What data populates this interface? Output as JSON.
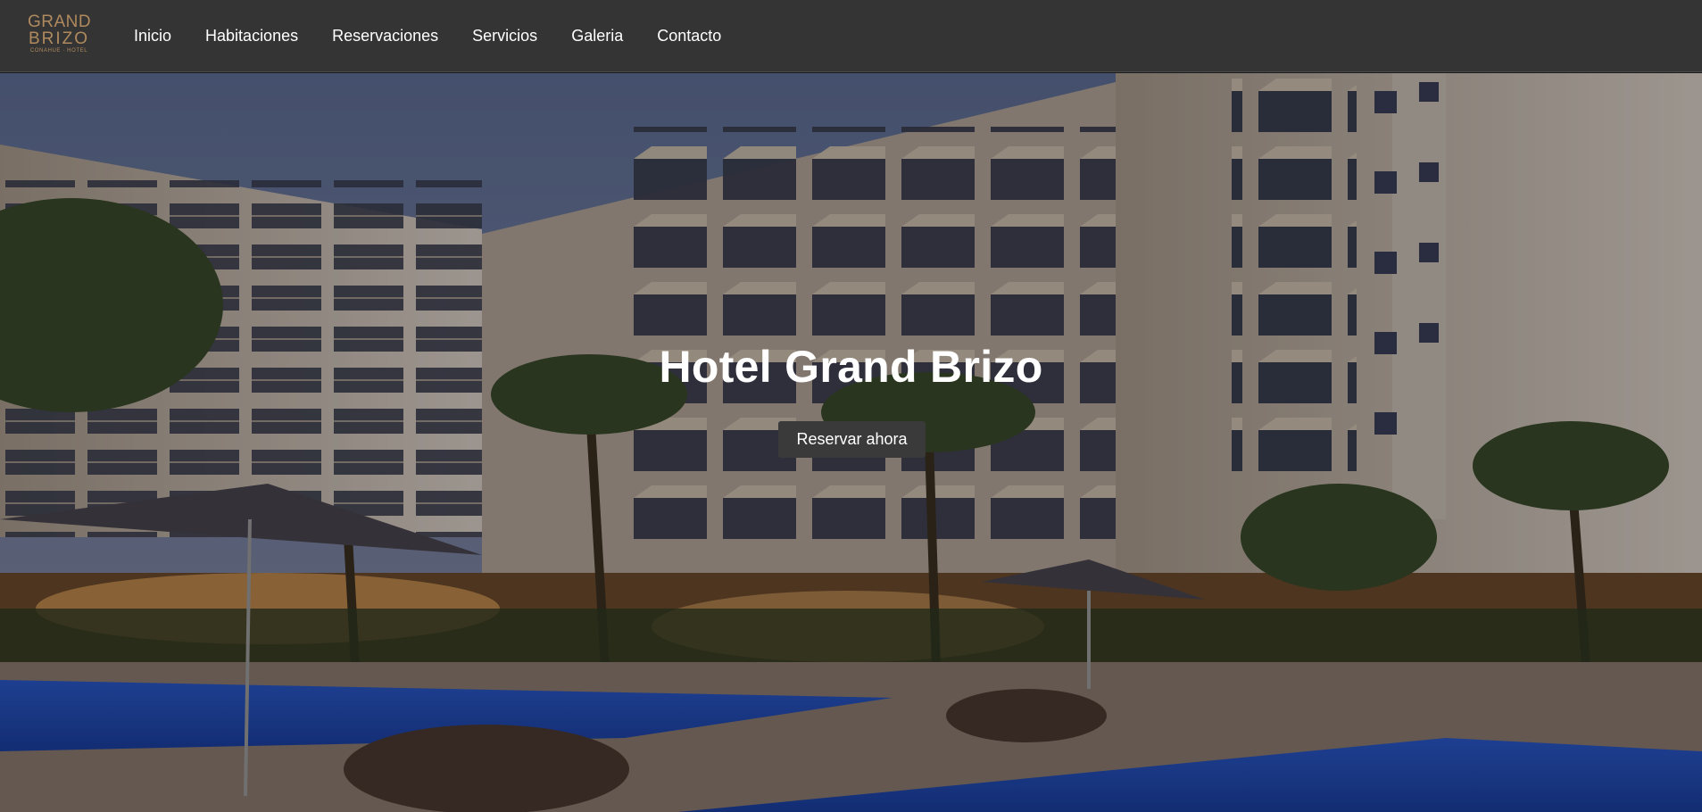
{
  "brand": {
    "logo_line1": "GRAND",
    "logo_line2": "BRIZO",
    "logo_line3": "CONAHUE · HOTEL"
  },
  "nav": {
    "items": [
      {
        "label": "Inicio"
      },
      {
        "label": "Habitaciones"
      },
      {
        "label": "Reservaciones"
      },
      {
        "label": "Servicios"
      },
      {
        "label": "Galeria"
      },
      {
        "label": "Contacto"
      }
    ]
  },
  "hero": {
    "title": "Hotel Grand Brizo",
    "cta_label": "Reservar ahora",
    "image_name": "hotel-pool-night-photo"
  },
  "colors": {
    "navbar_bg": "#343434",
    "logo_gold": "#b08a5e",
    "cta_bg": "#3a3a3a",
    "text": "#ffffff"
  }
}
